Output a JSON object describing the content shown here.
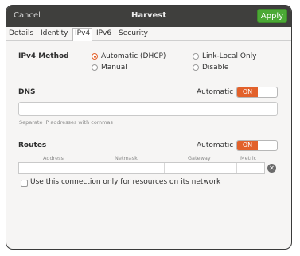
{
  "titlebar": {
    "cancel_label": "Cancel",
    "title": "Harvest",
    "apply_label": "Apply"
  },
  "tabs": [
    {
      "label": "Details",
      "active": false
    },
    {
      "label": "Identity",
      "active": false
    },
    {
      "label": "IPv4",
      "active": true
    },
    {
      "label": "IPv6",
      "active": false
    },
    {
      "label": "Security",
      "active": false
    }
  ],
  "ipv4_method": {
    "heading": "IPv4 Method",
    "options": [
      {
        "label": "Automatic (DHCP)",
        "selected": true
      },
      {
        "label": "Link-Local Only",
        "selected": false
      },
      {
        "label": "Manual",
        "selected": false
      },
      {
        "label": "Disable",
        "selected": false
      }
    ]
  },
  "dns": {
    "heading": "DNS",
    "automatic_label": "Automatic",
    "switch_label": "ON",
    "input_value": "",
    "hint": "Separate IP addresses with commas"
  },
  "routes": {
    "heading": "Routes",
    "automatic_label": "Automatic",
    "switch_label": "ON",
    "columns": [
      "Address",
      "Netmask",
      "Gateway",
      "Metric"
    ],
    "checkbox_label": "Use this connection only for resources on its network",
    "checkbox_checked": false
  },
  "colors": {
    "accent": "#e2612b",
    "apply": "#4ba935",
    "titlebar": "#3f3f3d"
  }
}
